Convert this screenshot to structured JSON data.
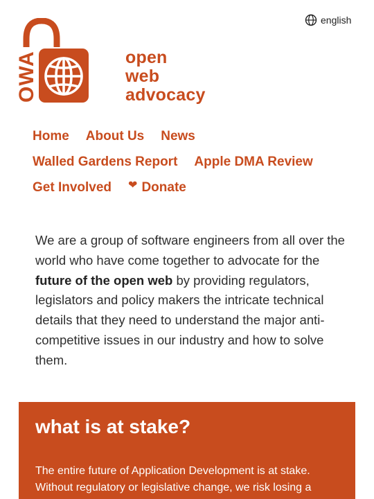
{
  "header": {
    "language_label": "english",
    "logo_letters": "OWA",
    "brand_lines": [
      "open",
      "web",
      "advocacy"
    ]
  },
  "nav": {
    "home": "Home",
    "about": "About Us",
    "news": "News",
    "walled_gardens": "Walled Gardens Report",
    "apple_dma": "Apple DMA Review",
    "get_involved": "Get Involved",
    "donate": "Donate"
  },
  "intro": {
    "text_before": "We are a group of software engineers from all over the world who have come together to advocate for the ",
    "emphasis": "future of the open web",
    "text_after": " by providing regulators, legislators and policy makers the intricate technical details that they need to understand the major anti-competitive issues in our industry and how to solve them."
  },
  "stake": {
    "title": "what is at stake?",
    "body": "The entire future of Application Development is at stake. Without regulatory or legislative change, we risk losing a"
  },
  "colors": {
    "brand": "#c84c1e",
    "text": "#2f2f2f",
    "background": "#ffffff"
  },
  "icons": {
    "language": "globe-icon",
    "donate": "heart-icon",
    "logo_globe": "globe-icon"
  }
}
